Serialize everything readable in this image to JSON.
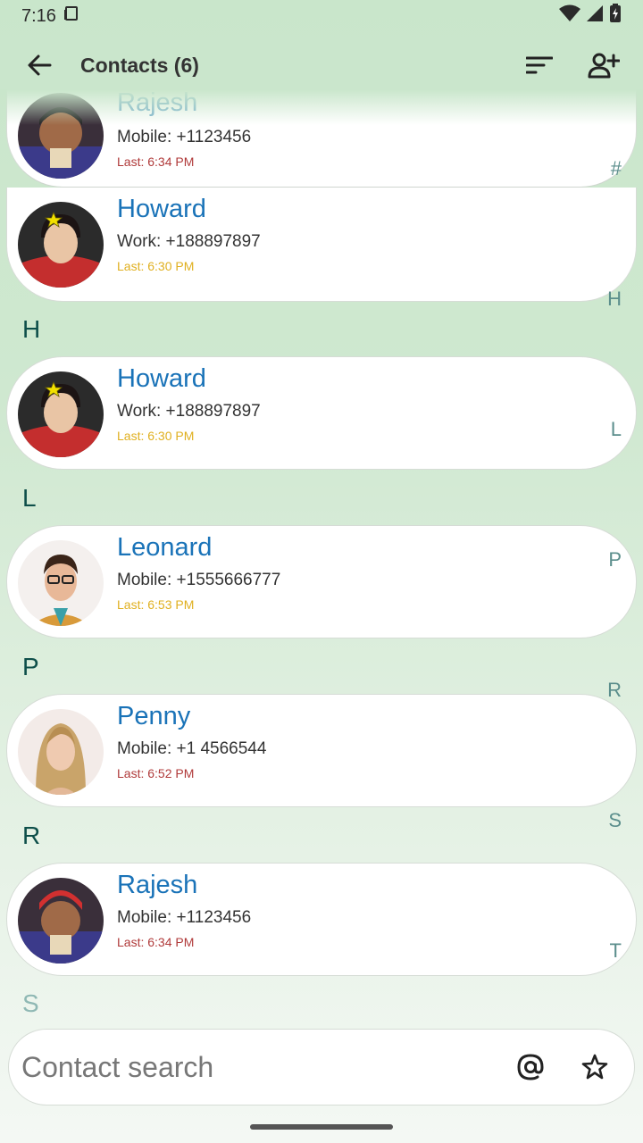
{
  "status": {
    "time": "7:16"
  },
  "appbar": {
    "title": "Contacts (6)"
  },
  "search": {
    "placeholder": "Contact search"
  },
  "sections": {
    "h": "H",
    "l": "L",
    "p": "P",
    "r": "R",
    "s": "S"
  },
  "index": {
    "hash": "#",
    "h": "H",
    "l": "L",
    "p": "P",
    "r": "R",
    "s": "S",
    "t": "T"
  },
  "contacts": [
    {
      "name": "Rajesh",
      "phone": "Mobile: +1123456",
      "last": "Last: 6:34 PM",
      "last_color": "#b03a3a"
    },
    {
      "name": "Howard",
      "phone": "Work: +188897897",
      "last": "Last: 6:30 PM",
      "last_color": "#e0b020"
    },
    {
      "name": "Howard",
      "phone": "Work: +188897897",
      "last": "Last: 6:30 PM",
      "last_color": "#e0b020"
    },
    {
      "name": "Leonard",
      "phone": "Mobile: +1555666777",
      "last": "Last: 6:53 PM",
      "last_color": "#e0b020"
    },
    {
      "name": "Penny",
      "phone": "Mobile: +1 4566544",
      "last": "Last: 6:52 PM",
      "last_color": "#b03a3a"
    },
    {
      "name": "Rajesh",
      "phone": "Mobile: +1123456",
      "last": "Last: 6:34 PM",
      "last_color": "#b03a3a"
    }
  ],
  "colors": {
    "name": "#1a73b8",
    "section": "#0e4f4a",
    "index": "#5b8e8c"
  }
}
